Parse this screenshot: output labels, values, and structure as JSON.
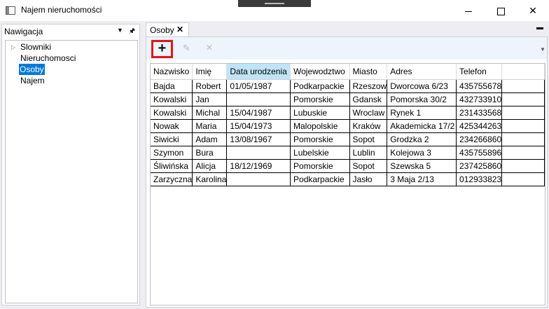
{
  "window": {
    "title": "Najem nieruchomości"
  },
  "navigation": {
    "title": "Nawigacja",
    "items": [
      {
        "label": "Slowniki"
      },
      {
        "label": "Nieruchomosci"
      },
      {
        "label": "Osoby"
      },
      {
        "label": "Najem"
      }
    ],
    "selected": "Osoby"
  },
  "document": {
    "tab_label": "Osoby",
    "toolbar": {
      "add_icon": "plus-icon",
      "edit_icon": "pencil-icon",
      "delete_icon": "x-icon"
    },
    "highlight_color": "#e0161b",
    "table": {
      "columns": [
        "Nazwisko",
        "Imię",
        "Data urodzenia",
        "Wojewodztwo",
        "Miasto",
        "Adres",
        "Telefon"
      ],
      "sorted_column": "Data urodzenia",
      "rows": [
        [
          "Bajda",
          "Robert",
          "01/05/1987",
          "Podkarpackie",
          "Rzeszow",
          "Dworcowa 6/23",
          "435755678"
        ],
        [
          "Kowalski",
          "Jan",
          "",
          "Pomorskie",
          "Gdansk",
          "Pomorska 30/2",
          "432733910"
        ],
        [
          "Kowalski",
          "Michal",
          "15/04/1987",
          "Lubuskie",
          "Wroclaw",
          "Rynek 1",
          "231433568"
        ],
        [
          "Nowak",
          "Maria",
          "15/04/1973",
          "Malopolskie",
          "Kraków",
          "Akademicka 17/2",
          "425344263"
        ],
        [
          "Siwicki",
          "Adam",
          "13/08/1967",
          "Pomorskie",
          "Sopot",
          "Grodzka 2",
          "234266860"
        ],
        [
          "Szymon",
          "Bura",
          "",
          "Lubelskie",
          "Lublin",
          "Kolejowa 3",
          "435755896"
        ],
        [
          "Śliwińska",
          "Alicja",
          "18/12/1969",
          "Pomorskie",
          "Sopot",
          "Szewska 5",
          "237425860"
        ],
        [
          "Zarzyczna",
          "Karolina",
          "",
          "Podkarpackie",
          "Jasło",
          "3 Maja 2/13",
          "012933823"
        ]
      ]
    }
  }
}
